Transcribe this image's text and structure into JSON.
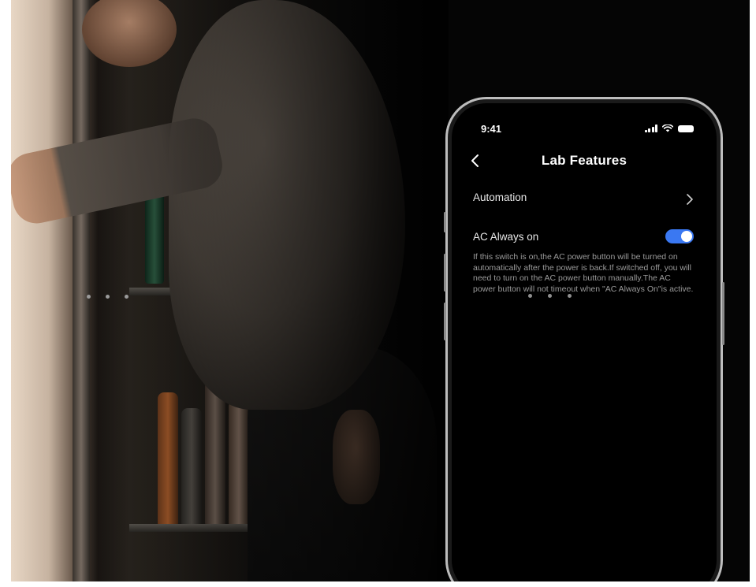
{
  "status_bar": {
    "time": "9:41"
  },
  "nav": {
    "title": "Lab Features"
  },
  "rows": {
    "automation": {
      "label": "Automation"
    },
    "ac_always_on": {
      "label": "AC Always on",
      "toggle_on": true,
      "description": "If this switch is on,the AC power button will be turned on automatically after the power is back.If switched off, you will need to turn on the AC power button manually.The AC power button will not timeout when \"AC Always On\"is active."
    }
  },
  "colors": {
    "toggle_accent": "#3a78f2",
    "background": "#000000"
  },
  "icons": [
    "back-icon",
    "chevron-right-icon",
    "signal-icon",
    "wifi-icon",
    "battery-icon"
  ]
}
